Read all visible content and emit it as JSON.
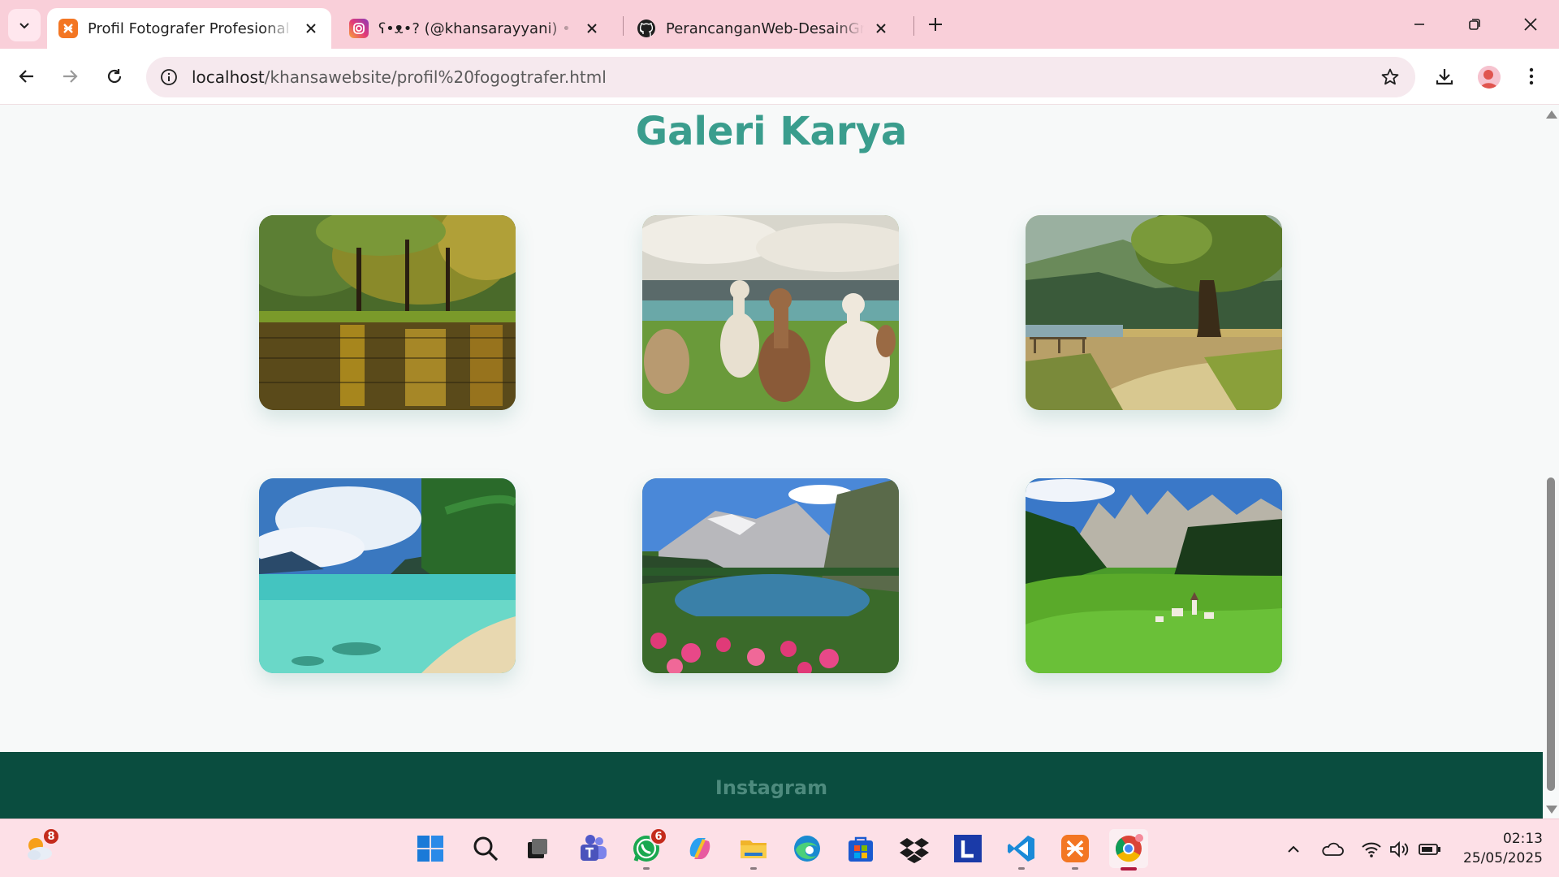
{
  "browser": {
    "tabs": [
      {
        "title": "Profil Fotografer Profesional de",
        "favicon": "xampp-icon",
        "active": true
      },
      {
        "title": "ʕ•ᴥ•? (@khansarayyani) • Instagram",
        "favicon": "instagram-icon",
        "active": false
      },
      {
        "title": "PerancanganWeb-DesainGrafis",
        "favicon": "github-icon",
        "active": false
      }
    ],
    "url_host": "localhost",
    "url_path": "/khansawebsite/profil%20fogogtrafer.html"
  },
  "page": {
    "gallery_title": "Galeri Karya",
    "photos": [
      {
        "name": "forest-lake-photo"
      },
      {
        "name": "alpacas-photo"
      },
      {
        "name": "tree-landscape-photo"
      },
      {
        "name": "tropical-beach-photo"
      },
      {
        "name": "alpine-lake-photo"
      },
      {
        "name": "dolomites-village-photo"
      }
    ],
    "footer_link": "Instagram"
  },
  "taskbar": {
    "weather_badge": "8",
    "whatsapp_badge": "6",
    "time": "02:13",
    "date": "25/05/2025"
  },
  "colors": {
    "accent": "#3a9d8d",
    "footer": "#0a4d3f",
    "tabstrip": "#f9cfd9"
  }
}
